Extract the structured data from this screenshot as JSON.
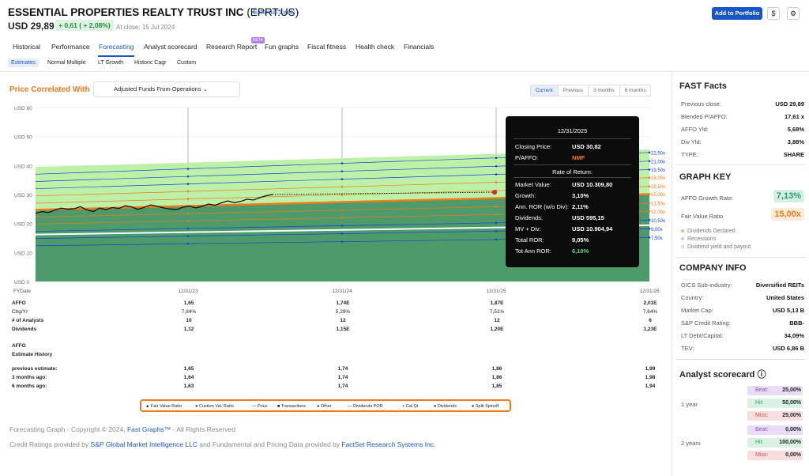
{
  "header": {
    "company": "ESSENTIAL PROPERTIES REALTY TRUST INC",
    "ticker": "(EPRT:US)",
    "external_links": "External Links ›",
    "price": "USD 29,89",
    "change": "+ 0,61 ( + 2,08%)",
    "close_date": "At close: 15 Jul 2024",
    "add_portfolio": "Add to Portfolio",
    "dollar_btn": "$",
    "settings_btn": "⚙"
  },
  "nav": {
    "tabs": [
      "Historical",
      "Performance",
      "Forecasting",
      "Analyst scorecard",
      "Research Report",
      "Fun graphs",
      "Fiscal fitness",
      "Health check",
      "Financials"
    ],
    "beta": "BETA",
    "subtabs": [
      "Estimates",
      "Normal Multiple",
      "LT Growth",
      "Historic Cagr",
      "Custom"
    ]
  },
  "chart_controls": {
    "title": "Price Correlated With",
    "dropdown": "Adjusted Funds From Operations",
    "ranges": [
      "Current",
      "Previous",
      "3 months",
      "6 months"
    ]
  },
  "chart_data": {
    "type": "line",
    "y_ticks": [
      "USD 60",
      "USD 50",
      "USD 40",
      "USD 30",
      "USD 20",
      "USD 10",
      "USD 0"
    ],
    "ylim": [
      0,
      60
    ],
    "x_ticks": [
      "FYDate",
      "12/31/23",
      "12/31/24",
      "12/31/25",
      "12/31/26"
    ],
    "multiples": [
      "22,50x",
      "21,00x",
      "19,50x",
      "18,00x",
      "16,50x",
      "15,00x",
      "13,50x",
      "12,00x",
      "10,50x",
      "9,00x",
      "7,50x"
    ],
    "multiple_colors": [
      "#1a3fd6",
      "#1a3fd6",
      "#1a3fd6",
      "#f07a1c",
      "#f07a1c",
      "#f07a1c",
      "#f07a1c",
      "#f07a1c",
      "#1a3fd6",
      "#1a3fd6",
      "#1a3fd6"
    ],
    "colors": {
      "fair_value": "#f07a1c",
      "projection_fill": "#b7ef9f",
      "history_fill": "#4d9a6a",
      "price": "#111111"
    }
  },
  "tooltip": {
    "date": "12/31/2025",
    "rows1": [
      {
        "k": "Closing Price:",
        "v": "USD 30,82"
      },
      {
        "k": "P/AFFO:",
        "v": "NMF"
      }
    ],
    "heading": "Rate of Return:",
    "rows2": [
      {
        "k": "Market Value:",
        "v": "USD 10.309,80"
      },
      {
        "k": "Growth:",
        "v": "3,10%"
      },
      {
        "k": "Ann. ROR (w/o Div):",
        "v": "2,11%"
      },
      {
        "k": "Dividends:",
        "v": "USD 595,15"
      },
      {
        "k": "MV + Div:",
        "v": "USD 10.904,94"
      },
      {
        "k": "Total ROR:",
        "v": "9,05%"
      },
      {
        "k": "Tot Ann ROR:",
        "v": "6,10%"
      }
    ]
  },
  "table": {
    "rows": [
      {
        "label": "AFFO",
        "vals": [
          "1,65",
          "1,74E",
          "1,87E",
          "2,01E"
        ]
      },
      {
        "label": "Chg/Yr",
        "vals": [
          "7,84%",
          "5,29%",
          "7,51%",
          "7,64%"
        ]
      },
      {
        "label": "# of Analysts",
        "vals": [
          "10",
          "12",
          "12",
          "6"
        ]
      },
      {
        "label": "Dividends",
        "vals": [
          "1,12",
          "1,15E",
          "1,20E",
          "1,23E"
        ]
      }
    ],
    "history_title": "AFFO",
    "history_sub": "Estimate History",
    "history_rows": [
      {
        "label": "previous estimate:",
        "vals": [
          "1,65",
          "1,74",
          "1,86",
          "1,99"
        ]
      },
      {
        "label": "3 months ago:",
        "vals": [
          "1,64",
          "1,74",
          "1,86",
          "1,98"
        ]
      },
      {
        "label": "6 months ago:",
        "vals": [
          "1,63",
          "1,74",
          "1,85",
          "1,94"
        ]
      }
    ]
  },
  "legend": [
    "▲ Fair Value Ratio",
    "● Custom Val. Ratio",
    "— Price",
    "■ Transactions",
    "● Other",
    "— Dividends POR",
    "+ Cal Qt",
    "● Dividends",
    "● Split Spinoff"
  ],
  "footer": {
    "line1_a": "Forecasting Graph - Copyright © 2024, ",
    "line1_link": "Fast Graphs™",
    "line1_b": " - All Rights Reserved",
    "line2_a": "Credit Ratings provided by ",
    "line2_link1": "S&P Global Market Intelligence LLC",
    "line2_b": " and Fundamental and Pricing Data provided by ",
    "line2_link2": "FactSet Research Systems Inc."
  },
  "fast_facts": {
    "title": "FAST Facts",
    "rows": [
      {
        "k": "Previous close:",
        "v": "USD 29,89"
      },
      {
        "k": "Blended P/AFFO:",
        "v": "17,61 x"
      },
      {
        "k": "AFFO Yld:",
        "v": "5,68%"
      },
      {
        "k": "Div Yld:",
        "v": "3,88%"
      },
      {
        "k": "TYPE:",
        "v": "SHARE"
      }
    ]
  },
  "graph_key": {
    "title": "GRAPH KEY",
    "growth_label": "AFFO Growth Rate:",
    "growth_value": "7,13%",
    "fv_label": "Fair Value Ratio",
    "fv_value": "15,00x",
    "bullets": [
      "Dividends Declared",
      "Recessions",
      "Dividend yield and payout"
    ]
  },
  "company_info": {
    "title": "COMPANY INFO",
    "rows": [
      {
        "k": "GICS Sub-industry:",
        "v": "Diversified REITs"
      },
      {
        "k": "Country:",
        "v": "United States"
      },
      {
        "k": "Market Cap:",
        "v": "USD 5,13 B"
      },
      {
        "k": "S&P Credit Rating:",
        "v": "BBB-"
      },
      {
        "k": "LT Debt/Capital:",
        "v": "34,09%"
      },
      {
        "k": "TEV:",
        "v": "USD 6,86 B"
      }
    ]
  },
  "analyst_scorecard": {
    "title": "Analyst scorecard",
    "info": "ⓘ",
    "periods": [
      {
        "label": "1 year",
        "beat": "25,00%",
        "hit": "50,00%",
        "miss": "25,00%"
      },
      {
        "label": "2 years",
        "beat": "0,00%",
        "hit": "100,00%",
        "miss": "0,00%"
      }
    ],
    "beat_label": "Beat:",
    "hit_label": "Hit:",
    "miss_label": "Miss:"
  }
}
